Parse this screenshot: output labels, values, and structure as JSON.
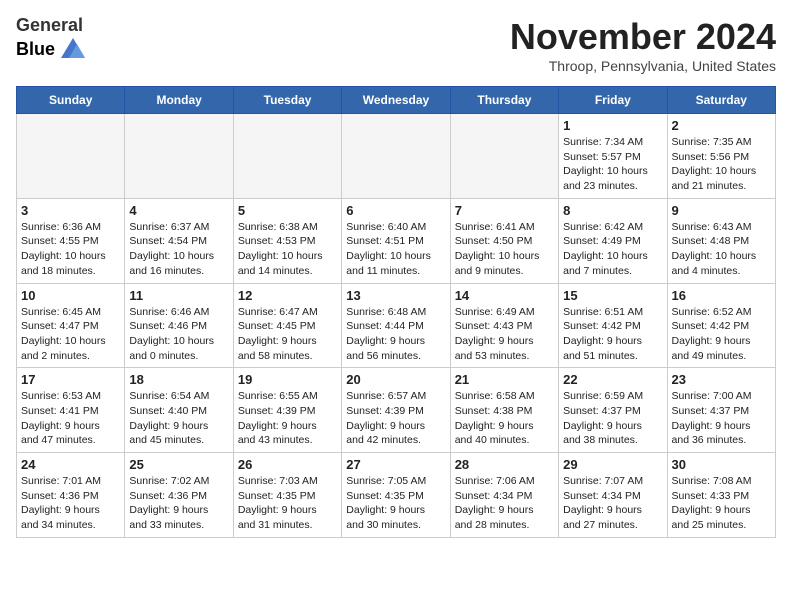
{
  "header": {
    "logo_line1": "General",
    "logo_line2": "Blue",
    "month_title": "November 2024",
    "location": "Throop, Pennsylvania, United States"
  },
  "days_of_week": [
    "Sunday",
    "Monday",
    "Tuesday",
    "Wednesday",
    "Thursday",
    "Friday",
    "Saturday"
  ],
  "weeks": [
    [
      {
        "day": "",
        "info": "",
        "empty": true
      },
      {
        "day": "",
        "info": "",
        "empty": true
      },
      {
        "day": "",
        "info": "",
        "empty": true
      },
      {
        "day": "",
        "info": "",
        "empty": true
      },
      {
        "day": "",
        "info": "",
        "empty": true
      },
      {
        "day": "1",
        "info": "Sunrise: 7:34 AM\nSunset: 5:57 PM\nDaylight: 10 hours\nand 23 minutes."
      },
      {
        "day": "2",
        "info": "Sunrise: 7:35 AM\nSunset: 5:56 PM\nDaylight: 10 hours\nand 21 minutes."
      }
    ],
    [
      {
        "day": "3",
        "info": "Sunrise: 6:36 AM\nSunset: 4:55 PM\nDaylight: 10 hours\nand 18 minutes."
      },
      {
        "day": "4",
        "info": "Sunrise: 6:37 AM\nSunset: 4:54 PM\nDaylight: 10 hours\nand 16 minutes."
      },
      {
        "day": "5",
        "info": "Sunrise: 6:38 AM\nSunset: 4:53 PM\nDaylight: 10 hours\nand 14 minutes."
      },
      {
        "day": "6",
        "info": "Sunrise: 6:40 AM\nSunset: 4:51 PM\nDaylight: 10 hours\nand 11 minutes."
      },
      {
        "day": "7",
        "info": "Sunrise: 6:41 AM\nSunset: 4:50 PM\nDaylight: 10 hours\nand 9 minutes."
      },
      {
        "day": "8",
        "info": "Sunrise: 6:42 AM\nSunset: 4:49 PM\nDaylight: 10 hours\nand 7 minutes."
      },
      {
        "day": "9",
        "info": "Sunrise: 6:43 AM\nSunset: 4:48 PM\nDaylight: 10 hours\nand 4 minutes."
      }
    ],
    [
      {
        "day": "10",
        "info": "Sunrise: 6:45 AM\nSunset: 4:47 PM\nDaylight: 10 hours\nand 2 minutes."
      },
      {
        "day": "11",
        "info": "Sunrise: 6:46 AM\nSunset: 4:46 PM\nDaylight: 10 hours\nand 0 minutes."
      },
      {
        "day": "12",
        "info": "Sunrise: 6:47 AM\nSunset: 4:45 PM\nDaylight: 9 hours\nand 58 minutes."
      },
      {
        "day": "13",
        "info": "Sunrise: 6:48 AM\nSunset: 4:44 PM\nDaylight: 9 hours\nand 56 minutes."
      },
      {
        "day": "14",
        "info": "Sunrise: 6:49 AM\nSunset: 4:43 PM\nDaylight: 9 hours\nand 53 minutes."
      },
      {
        "day": "15",
        "info": "Sunrise: 6:51 AM\nSunset: 4:42 PM\nDaylight: 9 hours\nand 51 minutes."
      },
      {
        "day": "16",
        "info": "Sunrise: 6:52 AM\nSunset: 4:42 PM\nDaylight: 9 hours\nand 49 minutes."
      }
    ],
    [
      {
        "day": "17",
        "info": "Sunrise: 6:53 AM\nSunset: 4:41 PM\nDaylight: 9 hours\nand 47 minutes."
      },
      {
        "day": "18",
        "info": "Sunrise: 6:54 AM\nSunset: 4:40 PM\nDaylight: 9 hours\nand 45 minutes."
      },
      {
        "day": "19",
        "info": "Sunrise: 6:55 AM\nSunset: 4:39 PM\nDaylight: 9 hours\nand 43 minutes."
      },
      {
        "day": "20",
        "info": "Sunrise: 6:57 AM\nSunset: 4:39 PM\nDaylight: 9 hours\nand 42 minutes."
      },
      {
        "day": "21",
        "info": "Sunrise: 6:58 AM\nSunset: 4:38 PM\nDaylight: 9 hours\nand 40 minutes."
      },
      {
        "day": "22",
        "info": "Sunrise: 6:59 AM\nSunset: 4:37 PM\nDaylight: 9 hours\nand 38 minutes."
      },
      {
        "day": "23",
        "info": "Sunrise: 7:00 AM\nSunset: 4:37 PM\nDaylight: 9 hours\nand 36 minutes."
      }
    ],
    [
      {
        "day": "24",
        "info": "Sunrise: 7:01 AM\nSunset: 4:36 PM\nDaylight: 9 hours\nand 34 minutes."
      },
      {
        "day": "25",
        "info": "Sunrise: 7:02 AM\nSunset: 4:36 PM\nDaylight: 9 hours\nand 33 minutes."
      },
      {
        "day": "26",
        "info": "Sunrise: 7:03 AM\nSunset: 4:35 PM\nDaylight: 9 hours\nand 31 minutes."
      },
      {
        "day": "27",
        "info": "Sunrise: 7:05 AM\nSunset: 4:35 PM\nDaylight: 9 hours\nand 30 minutes."
      },
      {
        "day": "28",
        "info": "Sunrise: 7:06 AM\nSunset: 4:34 PM\nDaylight: 9 hours\nand 28 minutes."
      },
      {
        "day": "29",
        "info": "Sunrise: 7:07 AM\nSunset: 4:34 PM\nDaylight: 9 hours\nand 27 minutes."
      },
      {
        "day": "30",
        "info": "Sunrise: 7:08 AM\nSunset: 4:33 PM\nDaylight: 9 hours\nand 25 minutes."
      }
    ]
  ]
}
